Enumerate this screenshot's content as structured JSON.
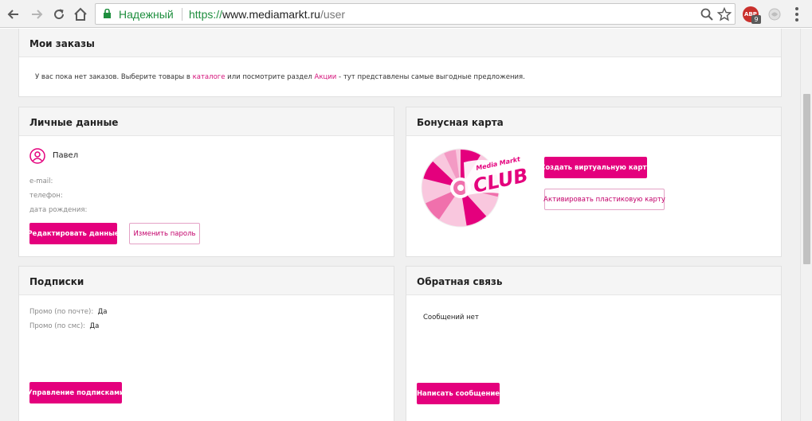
{
  "browser": {
    "secure_label": "Надежный",
    "url_protocol": "https://",
    "url_host": "www.mediamarkt.ru",
    "url_path": "/user",
    "extension_abp_label": "ABP",
    "extension_abp_badge": "9"
  },
  "orders": {
    "title": "Мои заказы",
    "text_part1": "У вас пока нет заказов. Выберите товары в ",
    "link_catalog": "каталоге",
    "text_part2": " или посмотрите раздел ",
    "link_promo": "Акции",
    "text_part3": " - тут представлены самые выгодные предложения."
  },
  "personal": {
    "title": "Личные данные",
    "name": "Павел",
    "email_label": "e-mail:",
    "phone_label": "телефон:",
    "birth_label": "дата рождения:",
    "edit_button": "Редактировать данные",
    "change_password_button": "Изменить пароль"
  },
  "bonus": {
    "title": "Бонусная карта",
    "logo_top": "Media Markt",
    "logo_main": "CLUB",
    "create_button": "Создать виртуальную карту",
    "activate_button": "Активировать пластиковую карту"
  },
  "subscriptions": {
    "title": "Подписки",
    "email_promo_label": "Промо (по почте):",
    "email_promo_value": "Да",
    "sms_promo_label": "Промо (по смс):",
    "sms_promo_value": "Да",
    "manage_button": "Управление подписками"
  },
  "feedback": {
    "title": "Обратная связь",
    "empty_text": "Сообщений нет",
    "write_button": "Написать сообщение"
  },
  "colors": {
    "accent": "#e4007d",
    "secure_green": "#1e8e3e",
    "panel_header": "#f5f5f5",
    "page_bg": "#f0f0f0"
  },
  "icons": [
    "back-icon",
    "forward-icon",
    "reload-icon",
    "home-icon",
    "lock-icon",
    "search-icon",
    "star-icon",
    "user-icon"
  ]
}
